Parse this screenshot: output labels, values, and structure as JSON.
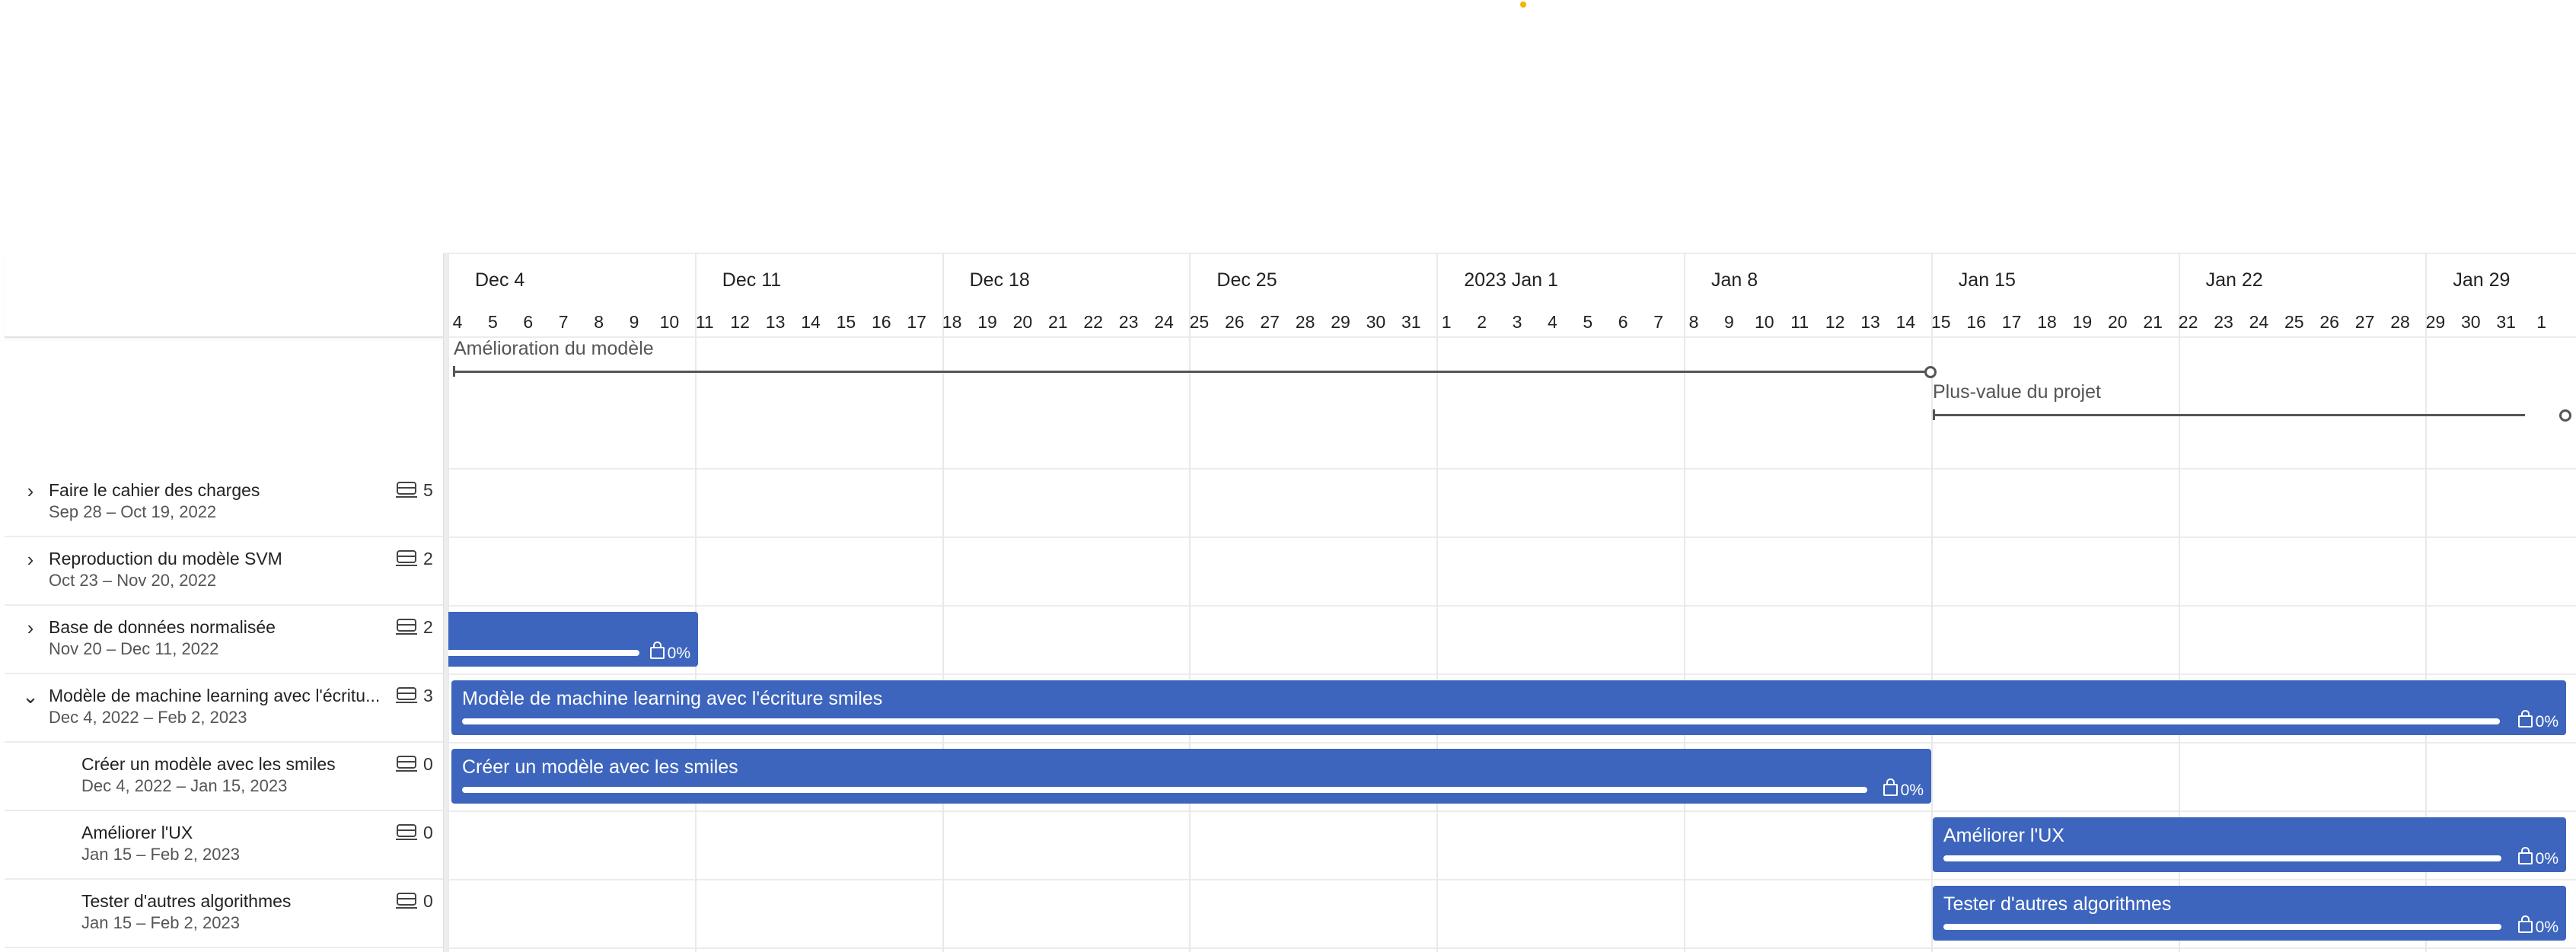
{
  "weeks": [
    "Dec 4",
    "Dec 11",
    "Dec 18",
    "Dec 25",
    "2023 Jan 1",
    "Jan 8",
    "Jan 15",
    "Jan 22",
    "Jan 29"
  ],
  "days": [
    "4",
    "5",
    "6",
    "7",
    "8",
    "9",
    "10",
    "11",
    "12",
    "13",
    "14",
    "15",
    "16",
    "17",
    "18",
    "19",
    "20",
    "21",
    "22",
    "23",
    "24",
    "25",
    "26",
    "27",
    "28",
    "29",
    "30",
    "31",
    "1",
    "2",
    "3",
    "4",
    "5",
    "6",
    "7",
    "8",
    "9",
    "10",
    "11",
    "12",
    "13",
    "14",
    "15",
    "16",
    "17",
    "18",
    "19",
    "20",
    "21",
    "22",
    "23",
    "24",
    "25",
    "26",
    "27",
    "28",
    "29",
    "30",
    "31",
    "1"
  ],
  "milestones": [
    {
      "label": "Amélioration du modèle"
    },
    {
      "label": "Plus-value du projet"
    }
  ],
  "tasks": [
    {
      "name": "Faire le cahier des charges",
      "dates": "Sep 28 – Oct 19, 2022",
      "count": "5",
      "chevron": "›",
      "indent": false
    },
    {
      "name": "Reproduction du modèle SVM",
      "dates": "Oct 23 – Nov 20, 2022",
      "count": "2",
      "chevron": "›",
      "indent": false
    },
    {
      "name": "Base de données normalisée",
      "dates": "Nov 20 – Dec 11, 2022",
      "count": "2",
      "chevron": "›",
      "indent": false
    },
    {
      "name": "Modèle de machine learning avec l'écritu...",
      "dates": "Dec 4, 2022 – Feb 2, 2023",
      "count": "3",
      "chevron": "⌄",
      "indent": false
    },
    {
      "name": "Créer un modèle avec les smiles",
      "dates": "Dec 4, 2022 – Jan 15, 2023",
      "count": "0",
      "chevron": "",
      "indent": true
    },
    {
      "name": "Améliorer l'UX",
      "dates": "Jan 15 – Feb 2, 2023",
      "count": "0",
      "chevron": "",
      "indent": true
    },
    {
      "name": "Tester d'autres algorithmes",
      "dates": "Jan 15 – Feb 2, 2023",
      "count": "0",
      "chevron": "",
      "indent": true
    }
  ],
  "bars": [
    {
      "title": "",
      "pct": "0%",
      "progress": 0
    },
    {
      "title": "Modèle de machine learning avec l'écriture smiles",
      "pct": "0%",
      "progress": 0
    },
    {
      "title": "Créer un modèle avec les smiles",
      "pct": "0%",
      "progress": 0
    },
    {
      "title": "Améliorer l'UX",
      "pct": "0%",
      "progress": 0
    },
    {
      "title": "Tester d'autres algorithmes",
      "pct": "0%",
      "progress": 0
    }
  ],
  "colors": {
    "bar": "#3d65bd",
    "milestone": "#555555",
    "accent_dot": "#f4b400"
  }
}
